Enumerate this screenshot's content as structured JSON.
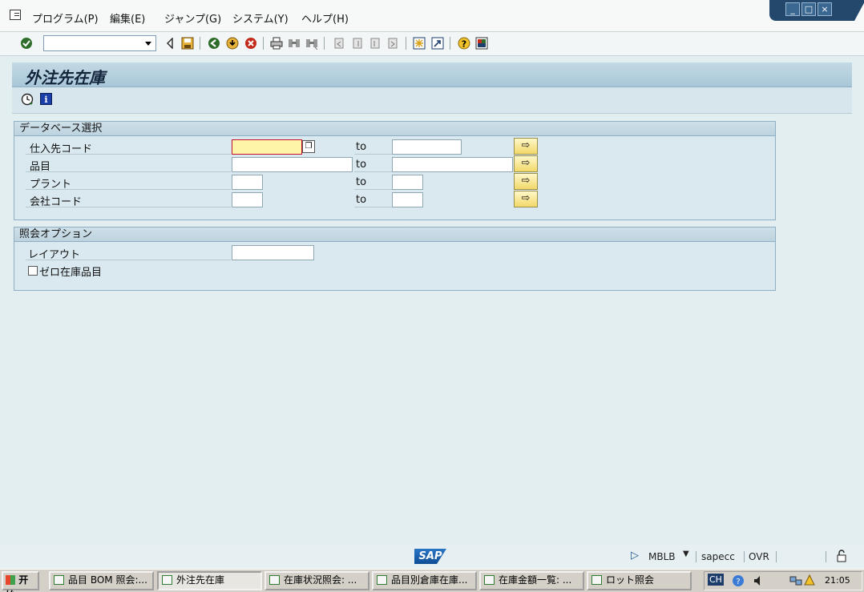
{
  "menubar": {
    "items": [
      "プログラム(P)",
      "編集(E)",
      "ジャンプ(G)",
      "システム(Y)",
      "ヘルプ(H)"
    ]
  },
  "window_controls": {
    "minimize": "_",
    "maximize": "□",
    "close": "×"
  },
  "toolbar": {
    "command_field_value": ""
  },
  "screen": {
    "title": "外注先在庫"
  },
  "group_database": {
    "title": "データベース選択",
    "rows": [
      {
        "label": "仕入先コード",
        "to": "to",
        "from_value": "",
        "to_value": ""
      },
      {
        "label": "品目",
        "to": "to",
        "from_value": "",
        "to_value": ""
      },
      {
        "label": "プラント",
        "to": "to",
        "from_value": "",
        "to_value": ""
      },
      {
        "label": "会社コード",
        "to": "to",
        "from_value": "",
        "to_value": ""
      }
    ]
  },
  "group_options": {
    "title": "照会オプション",
    "layout_label": "レイアウト",
    "layout_value": "",
    "zero_stock_label": "ゼロ在庫品目",
    "zero_stock_checked": false
  },
  "statusbar": {
    "logo": "SAP",
    "transaction": "MBLB",
    "server": "sapecc",
    "mode": "OVR"
  },
  "taskbar": {
    "start_label": "开始",
    "tasks": [
      "品目 BOM 照会:...",
      "外注先在庫",
      "在庫状況照会: ...",
      "品目別倉庫在庫...",
      "在庫金額一覧: ...",
      "ロット照会"
    ],
    "active_task": "外注先在庫",
    "tray": {
      "ch": "CH",
      "clock": "21:05"
    }
  }
}
